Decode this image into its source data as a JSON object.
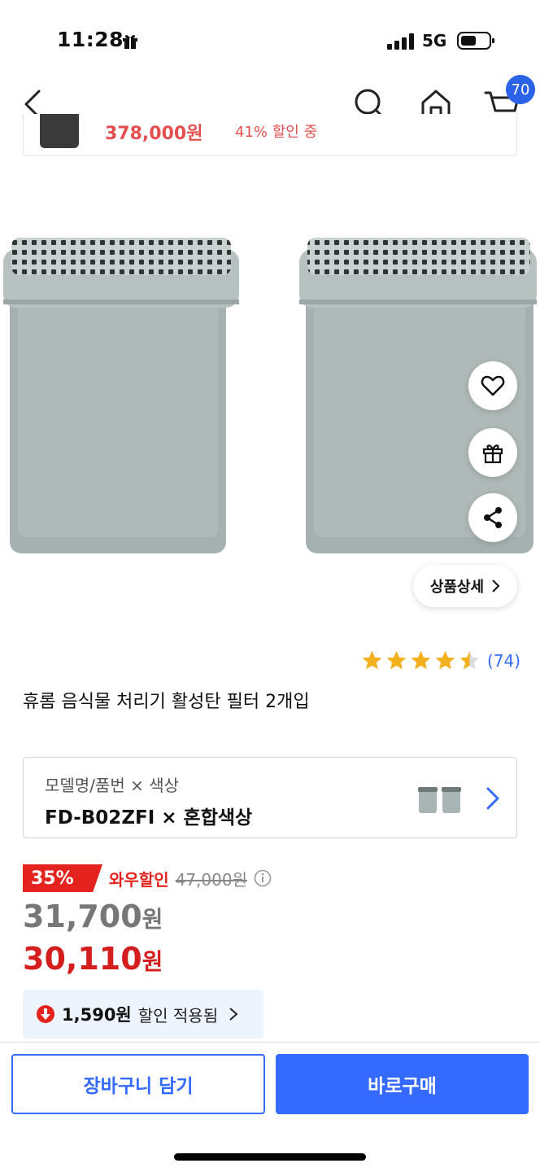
{
  "status_bar": {
    "time": "11:28",
    "network": "5G"
  },
  "nav": {
    "cart_count": "70"
  },
  "sticky": {
    "price": "378,000원",
    "discount": "41% 할인 중"
  },
  "actions": {
    "detail_label": "상품상세"
  },
  "rating": {
    "value": 4.5,
    "count": "(74)"
  },
  "product": {
    "title": "휴롬 음식물 처리기 활성탄 필터 2개입"
  },
  "option": {
    "label": "모델명/품번 × 색상",
    "value": "FD-B02ZFI × 혼합색상"
  },
  "pricing": {
    "discount_rate": "35%",
    "wow_label": "와우할인",
    "original_price": "47,000원",
    "price_1_number": "31,700",
    "price_1_unit": "원",
    "price_2_number": "30,110",
    "price_2_unit": "원"
  },
  "applied": {
    "amount": "1,590원",
    "text": "할인 적용됨"
  },
  "buttons": {
    "cart": "장바구니 담기",
    "buy": "바로구매"
  },
  "colors": {
    "accent": "#346aff",
    "sale_red": "#e4231f",
    "product_gray": "#a9b4b4"
  }
}
